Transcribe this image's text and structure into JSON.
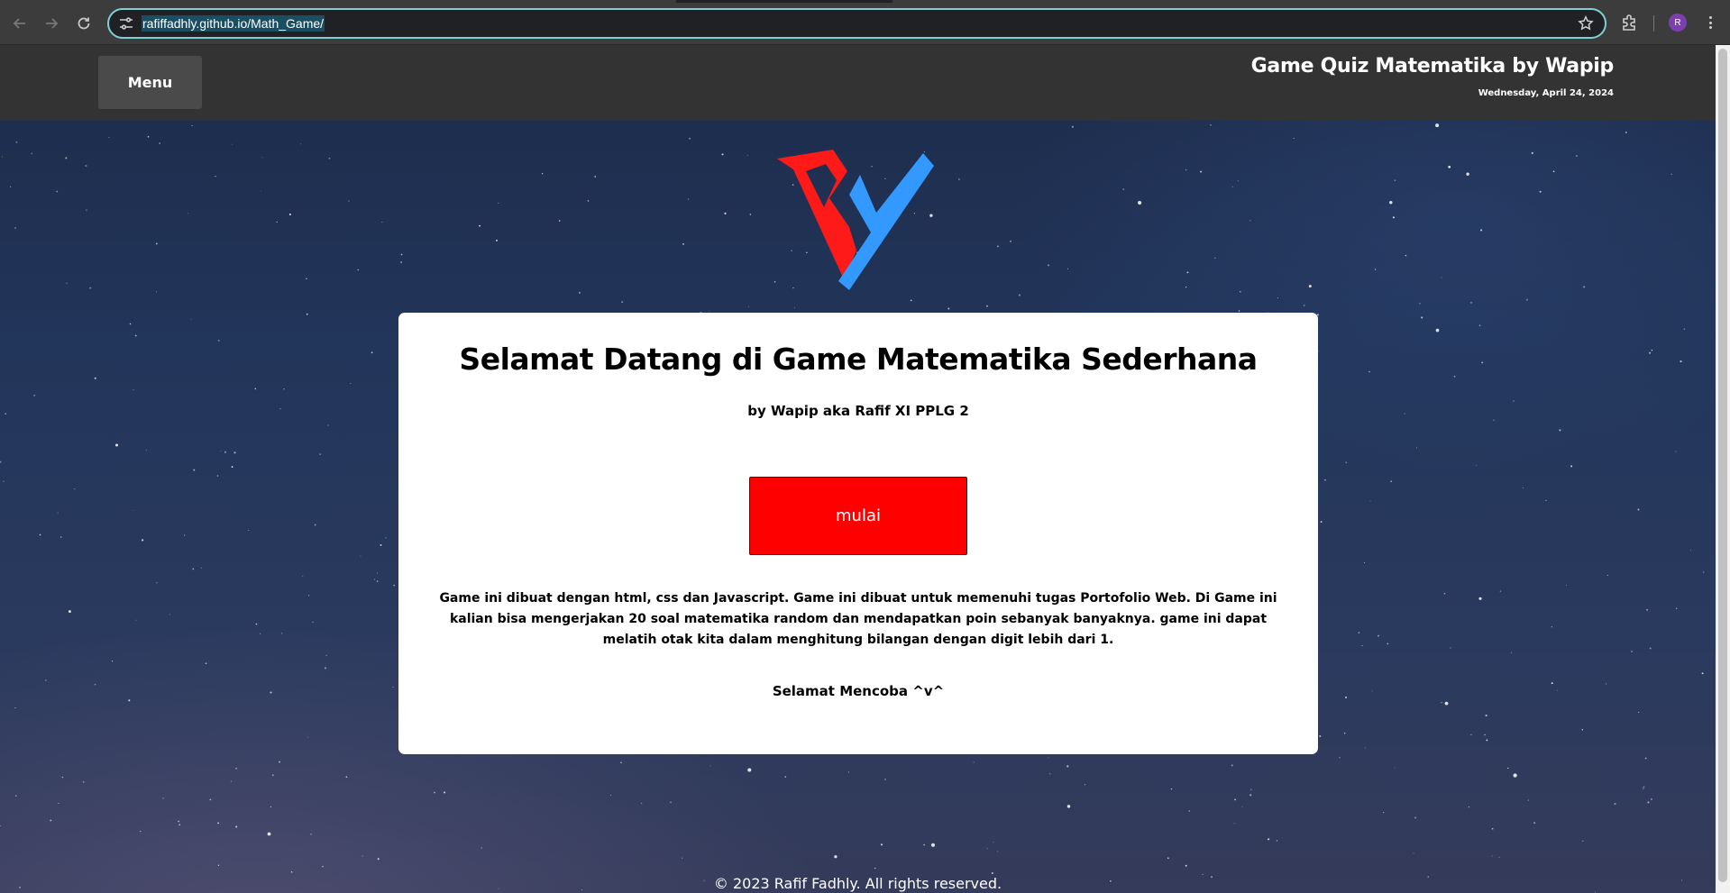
{
  "browser": {
    "url": "rafiffadhly.github.io/Math_Game/",
    "profile_initial": "R",
    "icons": {
      "back": "arrow-left-icon",
      "forward": "arrow-right-icon",
      "reload": "reload-icon",
      "site_info": "tune-icon",
      "bookmark": "star-icon",
      "extensions": "puzzle-icon",
      "menu": "kebab-icon"
    }
  },
  "header": {
    "menu_label": "Menu",
    "title": "Game Quiz Matematika by Wapip",
    "date": "Wednesday, April 24, 2024"
  },
  "logo": {
    "colors": {
      "red": "#ff1a1a",
      "blue": "#3399ff"
    }
  },
  "card": {
    "title": "Selamat Datang di Game Matematika Sederhana",
    "subtitle": "by Wapip aka Rafif XI PPLG 2",
    "start_button_label": "mulai",
    "description": "Game ini dibuat dengan html, css dan Javascript. Game ini dibuat untuk memenuhi tugas Portofolio Web. Di Game ini kalian bisa mengerjakan 20 soal matematika random dan mendapatkan poin sebanyak banyaknya. game ini dapat melatih otak kita dalam menghitung bilangan dengan digit lebih dari 1.",
    "closing": "Selamat Mencoba ^v^"
  },
  "footer": {
    "copyright": "© 2023 Rafif Fadhly. All rights reserved."
  },
  "colors": {
    "header_bg": "#333333",
    "menu_button_bg": "#4a4a4a",
    "start_button_bg": "#ff0000",
    "card_bg": "#ffffff",
    "omnibox_focus": "#7fd0d6"
  }
}
